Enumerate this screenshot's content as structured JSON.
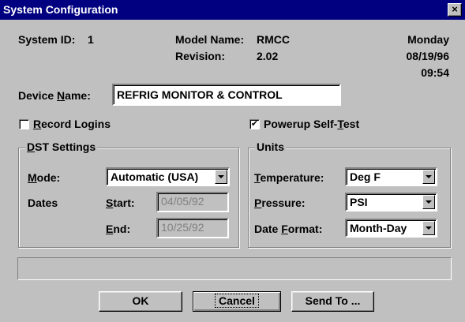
{
  "window": {
    "title": "System Configuration",
    "close_glyph": "×"
  },
  "info": {
    "system_id_label": "System ID:",
    "system_id_value": "1",
    "model_name_label": "Model Name:",
    "model_name_value": "RMCC",
    "revision_label": "Revision:",
    "revision_value": "2.02",
    "day": "Monday",
    "date": "08/19/96",
    "time": "09:54"
  },
  "device_name": {
    "label_pre": "Device ",
    "label_ul": "N",
    "label_post": "ame:",
    "value": "REFRIG MONITOR & CONTROL"
  },
  "record_logins": {
    "label_ul": "R",
    "label_post": "ecord Logins",
    "checked": false,
    "mark": ""
  },
  "powerup_self_test": {
    "label_pre": "Powerup Self-",
    "label_ul": "T",
    "label_post": "est",
    "checked": true,
    "mark": "✔"
  },
  "dst": {
    "legend_ul": "D",
    "legend_post": "ST Settings",
    "mode_label_ul": "M",
    "mode_label_post": "ode:",
    "mode_value": "Automatic (USA)",
    "dates_label": "Dates",
    "start_label_ul": "S",
    "start_label_post": "tart:",
    "start_value": "04/05/92",
    "end_label_ul": "E",
    "end_label_post": "nd:",
    "end_value": "10/25/92"
  },
  "units": {
    "legend": "Units",
    "temperature_label_ul": "T",
    "temperature_label_post": "emperature:",
    "temperature_value": "Deg F",
    "pressure_label_ul": "P",
    "pressure_label_post": "ressure:",
    "pressure_value": "PSI",
    "dateformat_label_pre": "Date ",
    "dateformat_label_ul": "F",
    "dateformat_label_post": "ormat:",
    "dateformat_value": "Month-Day"
  },
  "status_text": "",
  "buttons": {
    "ok": "OK",
    "cancel": "Cancel",
    "send_to": "Send To ..."
  }
}
